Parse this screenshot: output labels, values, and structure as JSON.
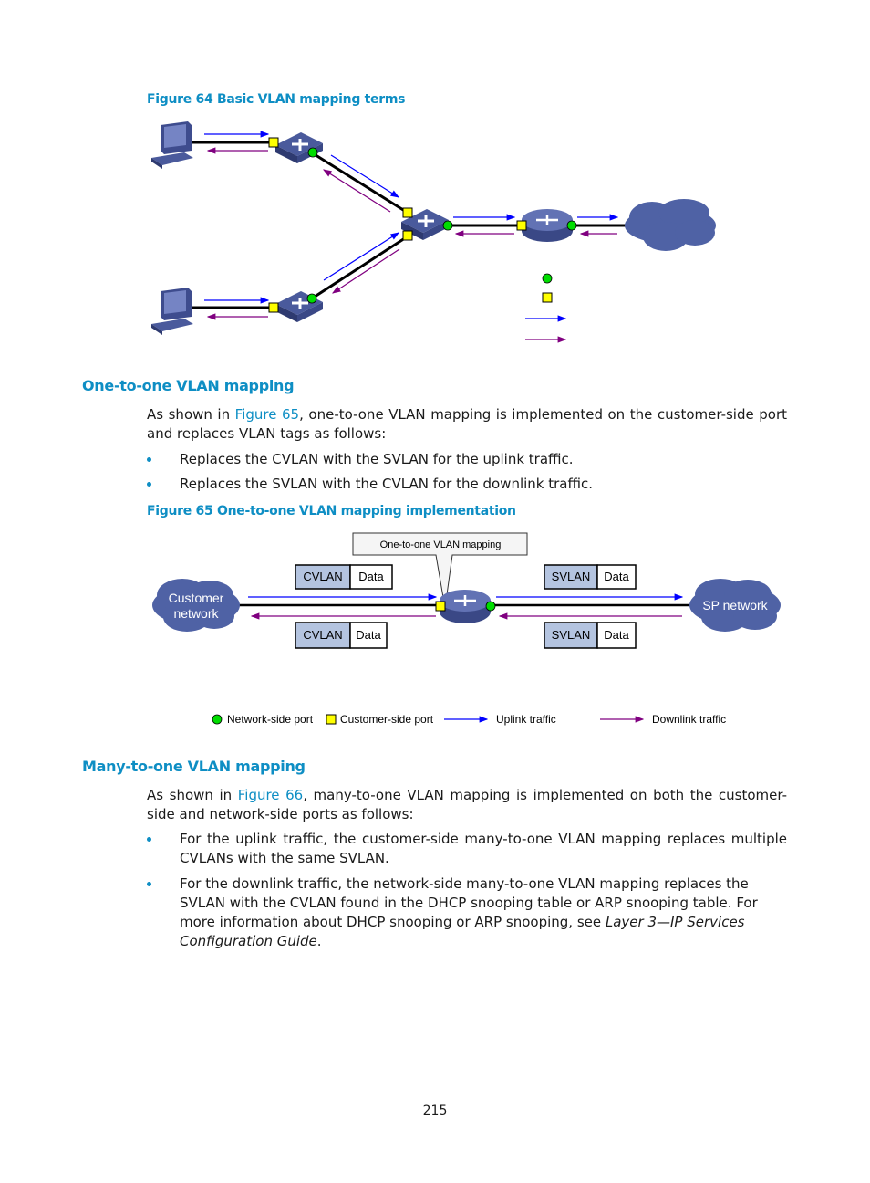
{
  "figure64": {
    "caption": "Figure 64 Basic VLAN mapping terms"
  },
  "section_one_to_one": {
    "title": "One-to-one VLAN mapping",
    "intro_prefix": "As shown in ",
    "intro_link": "Figure 65",
    "intro_suffix": ", one-to-one VLAN mapping is implemented on the customer-side port and replaces VLAN tags as follows:",
    "bullets": [
      "Replaces the CVLAN with the SVLAN for the uplink traffic.",
      "Replaces the SVLAN with the CVLAN for the downlink traffic."
    ]
  },
  "figure65": {
    "caption": "Figure 65 One-to-one VLAN mapping implementation",
    "callout": "One-to-one VLAN mapping",
    "customer_cloud": [
      "Customer",
      "network"
    ],
    "sp_cloud": "SP network",
    "left_up_frame": {
      "tag": "CVLAN",
      "data": "Data"
    },
    "left_down_frame": {
      "tag": "CVLAN",
      "data": "Data"
    },
    "right_up_frame": {
      "tag": "SVLAN",
      "data": "Data"
    },
    "right_down_frame": {
      "tag": "SVLAN",
      "data": "Data"
    },
    "legend": {
      "network_port": "Network-side port",
      "customer_port": "Customer-side port",
      "uplink": "Uplink traffic",
      "downlink": "Downlink traffic"
    }
  },
  "section_many_to_one": {
    "title": "Many-to-one VLAN mapping",
    "intro_prefix": "As shown in ",
    "intro_link": "Figure 66",
    "intro_suffix": ", many-to-one VLAN mapping is implemented on both the customer-side and network-side ports as follows:",
    "bullets": [
      {
        "text": "For the uplink traffic, the customer-side many-to-one VLAN mapping replaces multiple CVLANs with the same SVLAN."
      },
      {
        "text": "For the downlink traffic, the network-side many-to-one VLAN mapping replaces the SVLAN with the CVLAN found in the DHCP snooping table or ARP snooping table. For more information about DHCP snooping or ARP snooping, see ",
        "italic": "Layer 3—IP Services Configuration Guide",
        "tail": "."
      }
    ]
  },
  "colors": {
    "accent": "#0e8ec4",
    "uplink": "#0000ff",
    "downlink": "#800080",
    "network_port": "#00dd00",
    "customer_port": "#ffff00",
    "device": "#4a5a9c",
    "cloud": "#4f62a5",
    "vlan_tag_fill": "#b4c4e0"
  },
  "page_number": "215"
}
